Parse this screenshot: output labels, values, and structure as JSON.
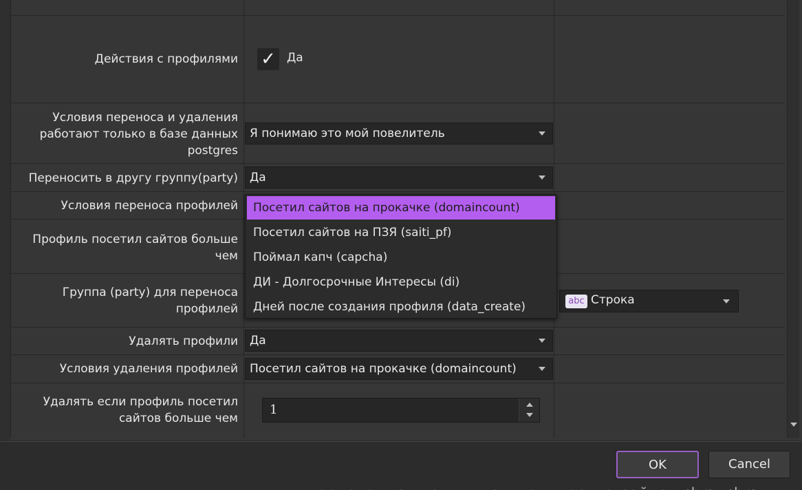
{
  "rows": [
    {
      "label": "Действия с профилями"
    },
    {
      "label": "Условия переноса и удаления работают только в базе данных postgres",
      "value": "Я понимаю это мой повелитель"
    },
    {
      "label": "Переносить в другу группу(party)",
      "value": "Да"
    },
    {
      "label": "Условия переноса профилей"
    },
    {
      "label": "Профиль посетил сайтов больше чем"
    },
    {
      "label": "Группа (party) для переноса профилей"
    },
    {
      "label": "Удалять профили",
      "value": "Да"
    },
    {
      "label": "Условия удаления профилей",
      "value": "Посетил сайтов на прокачке (domaincount)"
    },
    {
      "label": "Удалять если профиль посетил сайтов больше чем",
      "value": "1"
    }
  ],
  "checkbox": {
    "checked": true,
    "label": "Да",
    "glyph": "✓"
  },
  "popup": {
    "selected_index": 0,
    "items": [
      "Посетил сайтов на прокачке (domaincount)",
      "Посетил сайтов на ПЗЯ (saiti_pf)",
      "Поймал капч (capcha)",
      "ДИ - Долгосрочные Интересы (di)",
      "Дней после создания профиля (data_create)"
    ]
  },
  "type_combo": {
    "badge": "abc",
    "label": "Строка"
  },
  "buttons": {
    "ok": "OK",
    "cancel": "Cancel"
  },
  "background_text": "прокачались на нужном количестве сайтов<br><br>",
  "colors": {
    "accent": "#b45ef0",
    "ok_border": "#9b5fc8",
    "background": "#363636"
  }
}
